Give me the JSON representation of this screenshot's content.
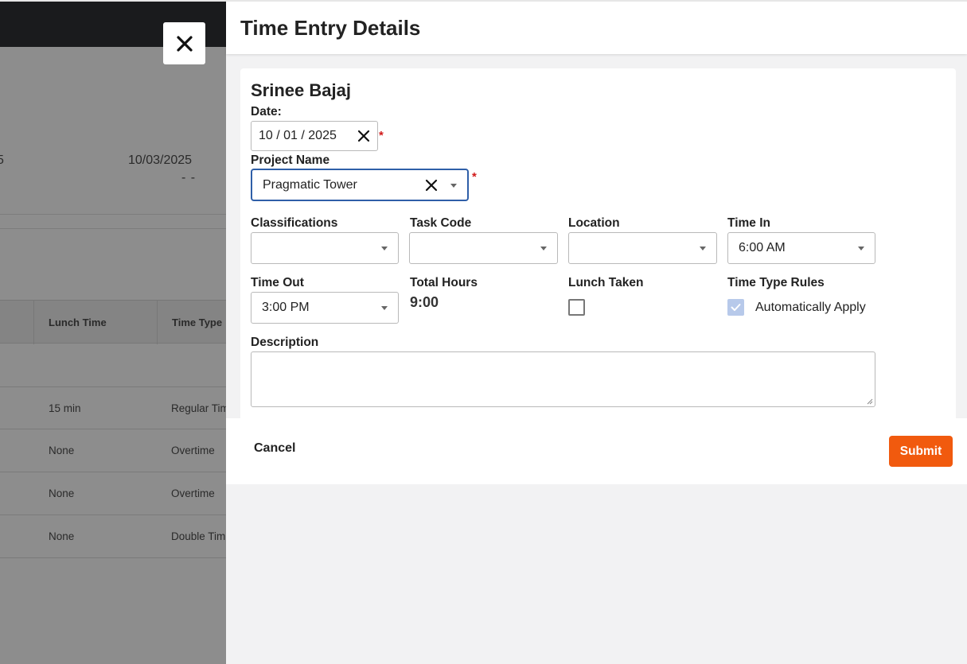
{
  "background": {
    "date_header": "10/03/2025",
    "date_value": "- -",
    "edge_fragment_1": "5",
    "edge_fragment_2": "-",
    "table": {
      "columns": [
        "Lunch Time",
        "Time Type"
      ],
      "rows": [
        {
          "lunch_time": "15 min",
          "time_type": "Regular Tim"
        },
        {
          "lunch_time": "None",
          "time_type": "Overtime"
        },
        {
          "lunch_time": "None",
          "time_type": "Overtime"
        },
        {
          "lunch_time": "None",
          "time_type": "Double Tim"
        }
      ]
    }
  },
  "drawer": {
    "title": "Time Entry Details",
    "employee_name": "Srinee Bajaj",
    "date": {
      "label": "Date:",
      "value": "10 / 01 / 2025",
      "required_mark": "*"
    },
    "project": {
      "label": "Project Name",
      "value": "Pragmatic Tower",
      "required_mark": "*"
    },
    "classifications": {
      "label": "Classifications",
      "value": ""
    },
    "task_code": {
      "label": "Task Code",
      "value": ""
    },
    "location": {
      "label": "Location",
      "value": ""
    },
    "time_in": {
      "label": "Time In",
      "value": "6:00 AM"
    },
    "time_out": {
      "label": "Time Out",
      "value": "3:00 PM"
    },
    "total_hours": {
      "label": "Total Hours",
      "value": "9:00"
    },
    "lunch_taken": {
      "label": "Lunch Taken",
      "checked": false
    },
    "time_type_rules": {
      "label": "Time Type Rules",
      "option_label": "Automatically Apply",
      "checked": true
    },
    "description": {
      "label": "Description",
      "value": ""
    },
    "footer": {
      "cancel_label": "Cancel",
      "submit_label": "Submit"
    }
  },
  "colors": {
    "accent_submit": "#f15a0e",
    "focus_border": "#2f5fa8",
    "required": "#d11a1a",
    "checkbox_checked": "#b7c9ea"
  }
}
